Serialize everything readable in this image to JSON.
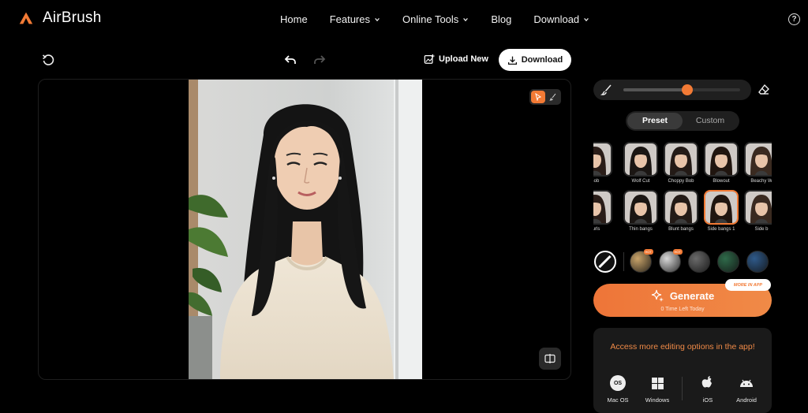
{
  "app": {
    "name": "AirBrush",
    "accent": "#f27a35"
  },
  "nav": {
    "items": [
      {
        "label": "Home",
        "dropdown": false
      },
      {
        "label": "Features",
        "dropdown": true
      },
      {
        "label": "Online Tools",
        "dropdown": true
      },
      {
        "label": "Blog",
        "dropdown": false
      },
      {
        "label": "Download",
        "dropdown": true
      }
    ],
    "help_icon": "question-circle-icon",
    "help_glyph": "?"
  },
  "toolbar": {
    "reset_icon": "reset-icon",
    "undo_icon": "undo-icon",
    "redo_icon": "redo-icon",
    "upload_label": "Upload New",
    "download_label": "Download"
  },
  "brush": {
    "size_fraction": 0.55
  },
  "tabs": {
    "preset": "Preset",
    "custom": "Custom",
    "active": "Preset"
  },
  "hairstyles": [
    {
      "label": "Bob",
      "row": 0,
      "col": 0
    },
    {
      "label": "Wolf Cut",
      "row": 0,
      "col": 1
    },
    {
      "label": "Choppy Bob",
      "row": 0,
      "col": 2
    },
    {
      "label": "Blowout",
      "row": 0,
      "col": 3
    },
    {
      "label": "Beachy W",
      "row": 0,
      "col": 4
    },
    {
      "label": "curls",
      "row": 1,
      "col": 0
    },
    {
      "label": "Thin bangs",
      "row": 1,
      "col": 1
    },
    {
      "label": "Blunt bangs",
      "row": 1,
      "col": 2
    },
    {
      "label": "Side bangs 1",
      "row": 1,
      "col": 3,
      "selected": true
    },
    {
      "label": "Side b",
      "row": 1,
      "col": 4
    }
  ],
  "hair_colors": [
    {
      "name": "none",
      "color": "#111111"
    },
    {
      "name": "blonde",
      "color": "#c9a46a",
      "tag": "HOT"
    },
    {
      "name": "platinum",
      "color": "#d8d8d8",
      "tag": "HOT"
    },
    {
      "name": "gray",
      "color": "#6a6a6a"
    },
    {
      "name": "green",
      "color": "#2f6a4a"
    },
    {
      "name": "blue",
      "color": "#2f5a8a"
    }
  ],
  "generate": {
    "label": "Generate",
    "subtext": "0 Time Left Today",
    "badge": "MORE IN APP"
  },
  "app_card": {
    "title": "Access more editing options in the app!",
    "platforms": [
      {
        "label": "Mac OS",
        "icon": "macos-icon",
        "glyph": "OS"
      },
      {
        "label": "Windows",
        "icon": "windows-icon"
      },
      {
        "label": "iOS",
        "icon": "apple-icon"
      },
      {
        "label": "Android",
        "icon": "android-icon"
      }
    ]
  }
}
